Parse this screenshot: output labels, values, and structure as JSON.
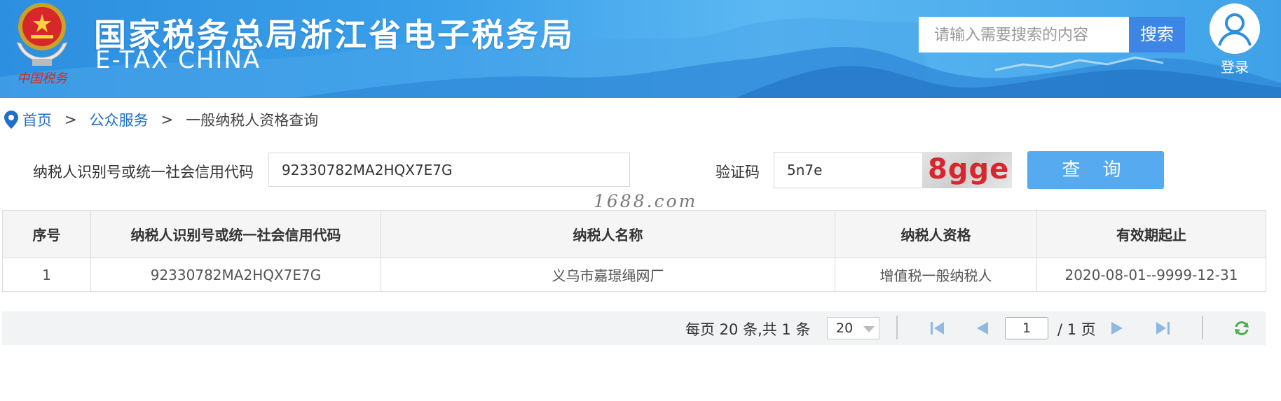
{
  "header": {
    "title": "国家税务总局浙江省电子税务局",
    "subtitle": "E-TAX CHINA",
    "emblem_caption": "中国税务",
    "search_placeholder": "请输入需要搜索的内容",
    "search_button": "搜索",
    "login_label": "登录"
  },
  "breadcrumb": {
    "home": "首页",
    "sep1": ">",
    "section": "公众服务",
    "sep2": ">",
    "current": "一般纳税人资格查询"
  },
  "form": {
    "id_label": "纳税人识别号或统一社会信用代码",
    "id_value": "92330782MA2HQX7E7G",
    "captcha_label": "验证码",
    "captcha_value": "5n7e",
    "captcha_image_text": "8gge",
    "query_button": "查 询"
  },
  "watermark": "1688.com",
  "table": {
    "headers": [
      "序号",
      "纳税人识别号或统一社会信用代码",
      "纳税人名称",
      "纳税人资格",
      "有效期起止"
    ],
    "rows": [
      [
        "1",
        "92330782MA2HQX7E7G",
        "义乌市嘉璟绳网厂",
        "增值税一般纳税人",
        "2020-08-01--9999-12-31"
      ]
    ]
  },
  "pager": {
    "total_text": "每页 20 条,共 1 条",
    "page_size": "20",
    "current_page": "1",
    "page_total_text": "/ 1 页"
  },
  "colors": {
    "header_blue": "#3aa0ea",
    "search_button": "#3e86e6",
    "query_button": "#55aaf0",
    "link": "#1f6fc9",
    "captcha_text": "#d9262e"
  }
}
